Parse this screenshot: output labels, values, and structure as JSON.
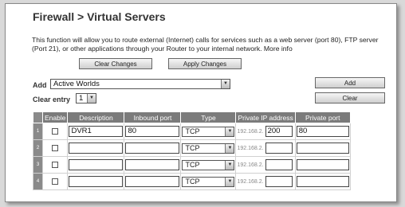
{
  "page": {
    "title": "Firewall > Virtual Servers",
    "description": "This function will allow you to route external (Internet) calls for services such as a web server (port 80), FTP server (Port 21), or other applications through your Router to your internal network. More info"
  },
  "buttons": {
    "clear_changes": "Clear Changes",
    "apply_changes": "Apply Changes",
    "add": "Add",
    "clear": "Clear"
  },
  "add_row": {
    "label": "Add",
    "selected": "Active Worlds"
  },
  "clear_entry": {
    "label": "Clear entry",
    "selected": "1"
  },
  "table": {
    "headers": [
      "Enable",
      "Description",
      "Inbound port",
      "Type",
      "Private IP address",
      "Private port"
    ],
    "rows": [
      {
        "num": "1",
        "description": "DVR1",
        "inbound_port": "80",
        "type": "TCP",
        "ip_prefix": "192.168.2.",
        "ip_last": "200",
        "private_port": "80"
      },
      {
        "num": "2",
        "description": "",
        "inbound_port": "",
        "type": "TCP",
        "ip_prefix": "192.168.2.",
        "ip_last": "",
        "private_port": ""
      },
      {
        "num": "3",
        "description": "",
        "inbound_port": "",
        "type": "TCP",
        "ip_prefix": "192.168.2.",
        "ip_last": "",
        "private_port": ""
      },
      {
        "num": "4",
        "description": "",
        "inbound_port": "",
        "type": "TCP",
        "ip_prefix": "192.168.2.",
        "ip_last": "",
        "private_port": ""
      }
    ]
  }
}
